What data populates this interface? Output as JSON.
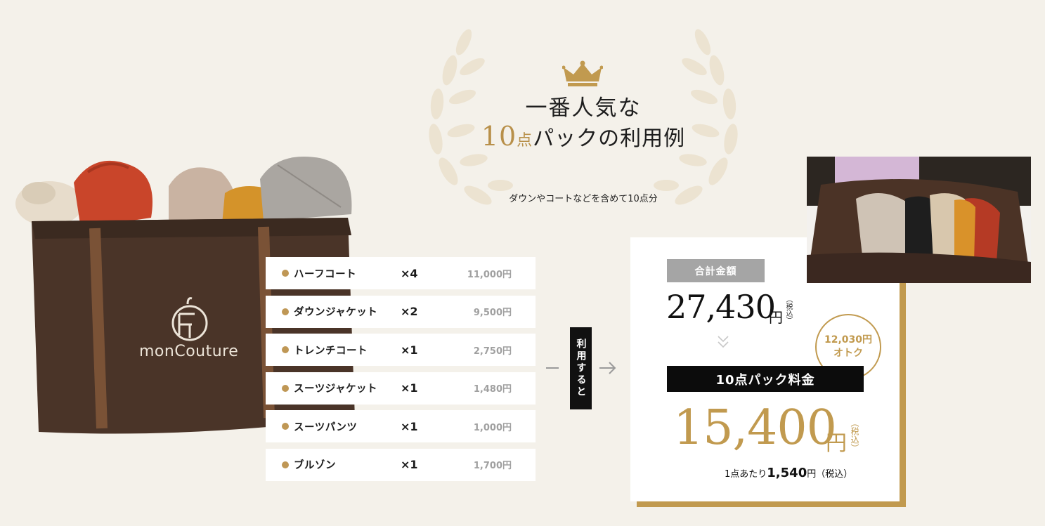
{
  "heading": {
    "line1": "一番人気な",
    "line2_num": "10",
    "line2_unit": "点",
    "line2_rest": "パックの利用例",
    "subline": "ダウンやコートなどを含めて10点分"
  },
  "bag": {
    "logo_text": "monCouture"
  },
  "items": [
    {
      "name": "ハーフコート",
      "qty": "×4",
      "price": "11,000円"
    },
    {
      "name": "ダウンジャケット",
      "qty": "×2",
      "price": "9,500円"
    },
    {
      "name": "トレンチコート",
      "qty": "×1",
      "price": "2,750円"
    },
    {
      "name": "スーツジャケット",
      "qty": "×1",
      "price": "1,480円"
    },
    {
      "name": "スーツパンツ",
      "qty": "×1",
      "price": "1,000円"
    },
    {
      "name": "ブルゾン",
      "qty": "×1",
      "price": "1,700円"
    }
  ],
  "flow": {
    "label": "利用すると"
  },
  "result": {
    "total_label": "合計金額",
    "total_amount": "27,430",
    "yen": "円",
    "tax_note": "（税込）",
    "savings_amount": "12,030円",
    "savings_label": "オトク",
    "pack_label": "10点パック料金",
    "pack_amount": "15,400",
    "per_item_prefix": "1点あたり",
    "per_item_amount": "1,540",
    "per_item_suffix": "円（税込）"
  },
  "colors": {
    "gold": "#c19a4f",
    "background": "#f4f1ea",
    "dark": "#0c0c0c",
    "gray_tag": "#a5a5a5"
  }
}
